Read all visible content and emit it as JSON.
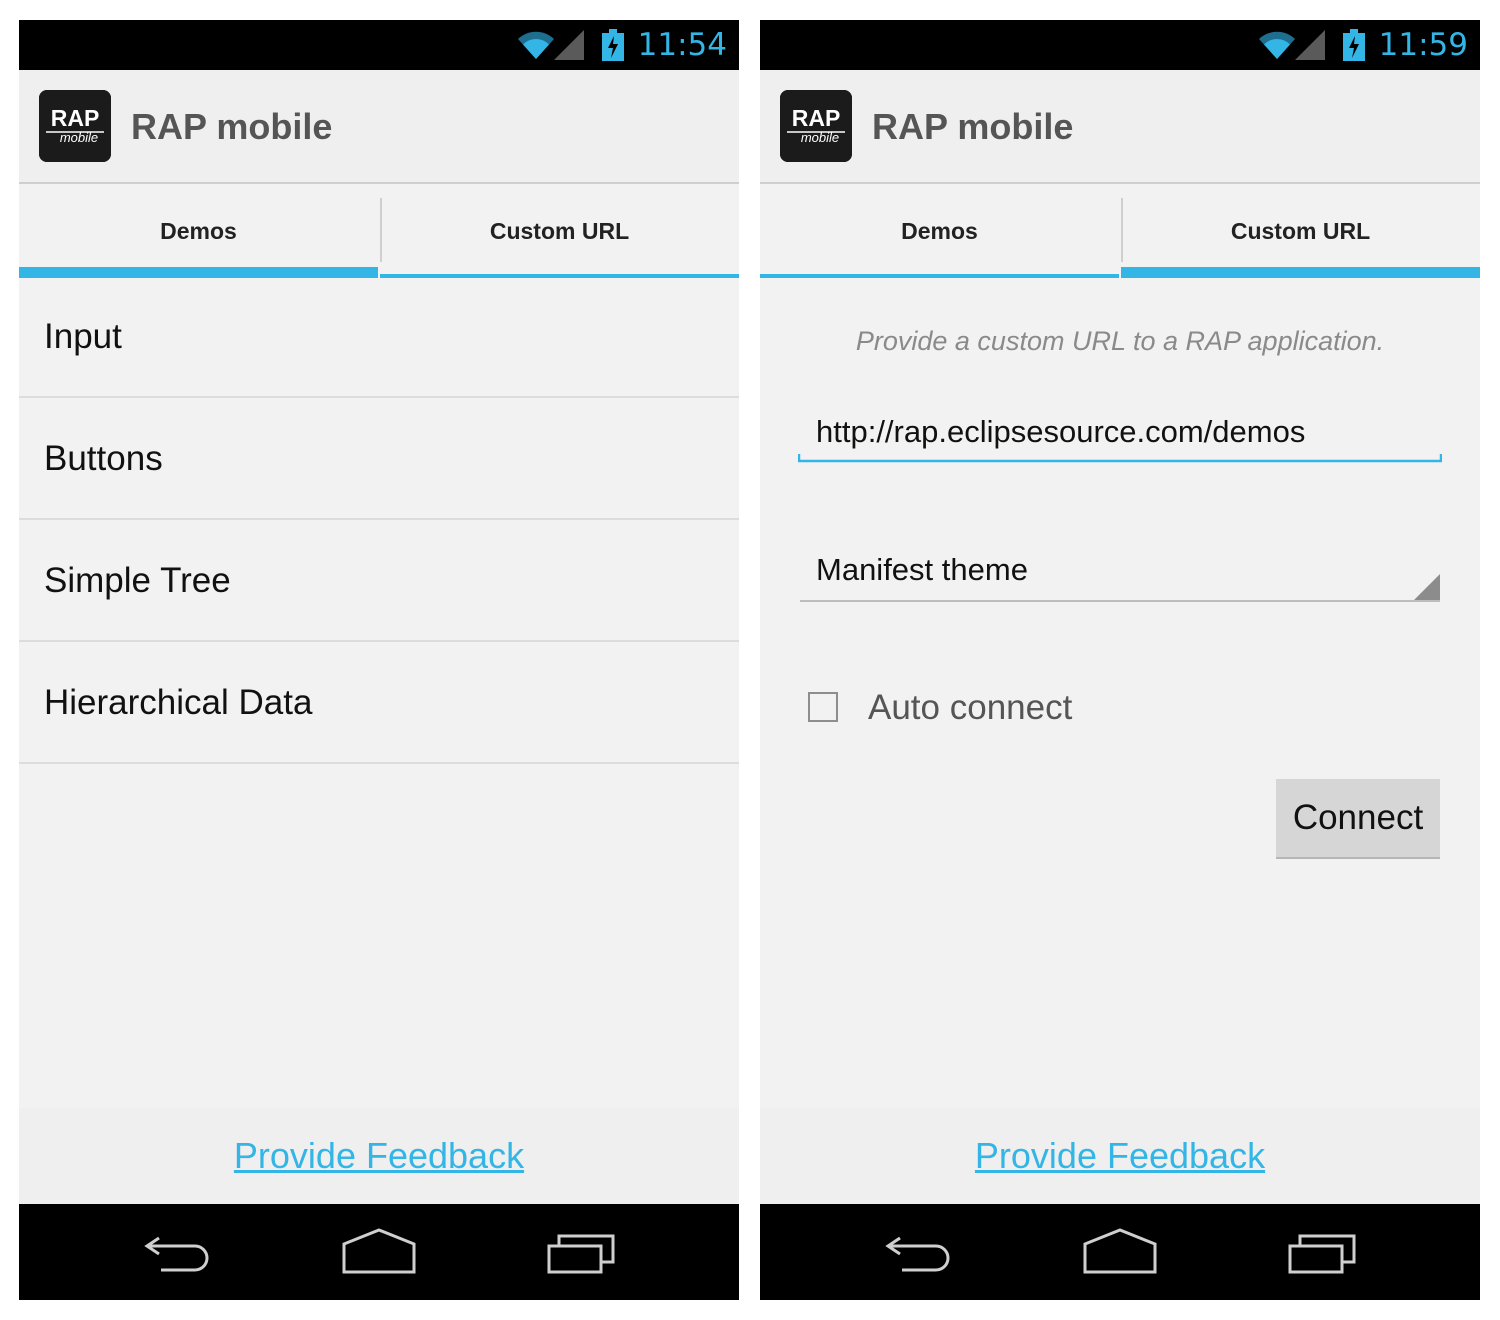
{
  "colors": {
    "accent": "#33b5e5",
    "status_bar": "#000000",
    "background": "#f2f2f2"
  },
  "screens": [
    {
      "status_bar": {
        "time": "11:54",
        "icons": [
          "wifi-icon",
          "signal-icon",
          "battery-charging-icon"
        ]
      },
      "action_bar": {
        "title": "RAP mobile",
        "logo_text": "RAP",
        "logo_subtext": "mobile"
      },
      "tabs": [
        {
          "label": "Demos",
          "active": true
        },
        {
          "label": "Custom URL",
          "active": false
        }
      ],
      "list_items": [
        {
          "label": "Input"
        },
        {
          "label": "Buttons"
        },
        {
          "label": "Simple Tree"
        },
        {
          "label": "Hierarchical Data"
        }
      ],
      "footer": {
        "link": "Provide Feedback"
      },
      "nav_bar": [
        "back-icon",
        "home-icon",
        "recent-apps-icon"
      ]
    },
    {
      "status_bar": {
        "time": "11:59",
        "icons": [
          "wifi-icon",
          "signal-icon",
          "battery-charging-icon"
        ]
      },
      "action_bar": {
        "title": "RAP mobile",
        "logo_text": "RAP",
        "logo_subtext": "mobile"
      },
      "tabs": [
        {
          "label": "Demos",
          "active": false
        },
        {
          "label": "Custom URL",
          "active": true
        }
      ],
      "custom_url": {
        "hint": "Provide a custom URL to a RAP application.",
        "url_value": "http://rap.eclipsesource.com/demos",
        "theme_selected": "Manifest theme",
        "auto_connect_label": "Auto connect",
        "auto_connect_checked": false,
        "connect_label": "Connect"
      },
      "footer": {
        "link": "Provide Feedback"
      },
      "nav_bar": [
        "back-icon",
        "home-icon",
        "recent-apps-icon"
      ]
    }
  ]
}
